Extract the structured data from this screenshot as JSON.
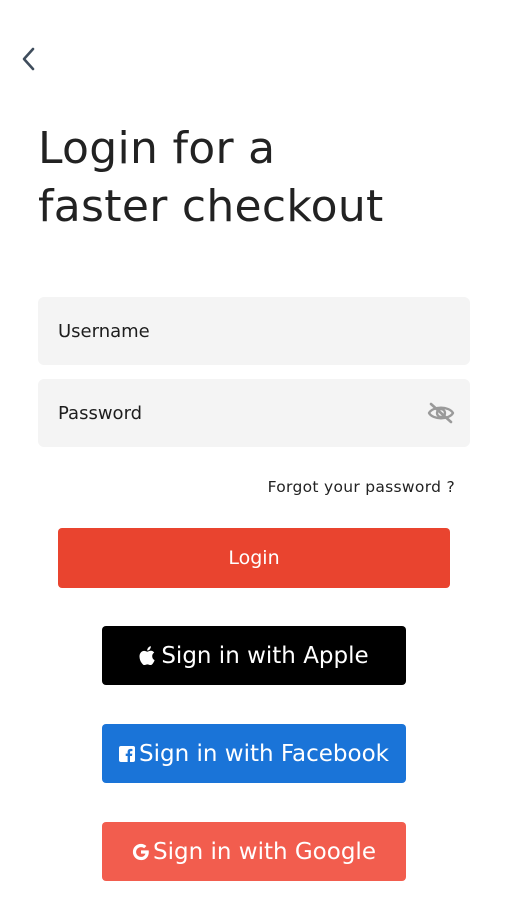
{
  "header": {
    "back_icon": "chevron-left-icon"
  },
  "title": {
    "line1": "Login for a",
    "line2": "faster checkout"
  },
  "form": {
    "username_placeholder": "Username",
    "password_placeholder": "Password",
    "password_toggle_icon": "eye-off-icon",
    "forgot_label": "Forgot your password ?"
  },
  "buttons": {
    "login_label": "Login",
    "apple_label": "Sign in with Apple",
    "facebook_label": "Sign in with Facebook",
    "google_label": "Sign in with Google"
  },
  "colors": {
    "login": "#e9442f",
    "apple": "#000000",
    "facebook": "#1a74d8",
    "google": "#f25d4e",
    "field_bg": "#f4f4f4"
  }
}
